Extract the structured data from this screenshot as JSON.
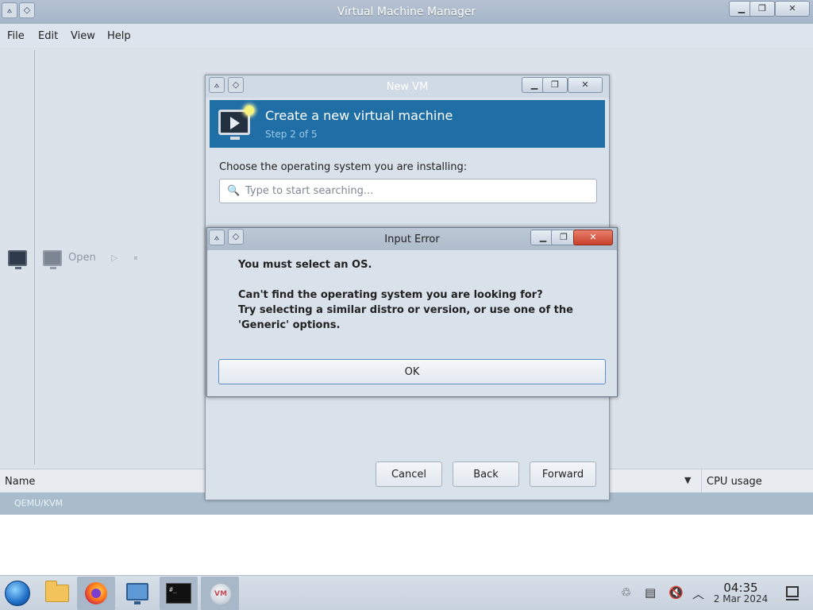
{
  "main_window": {
    "title": "Virtual Machine Manager",
    "menu": [
      "File",
      "Edit",
      "View",
      "Help"
    ],
    "toolbar": {
      "open_label": "Open"
    },
    "table_headers": {
      "name": "Name",
      "cpu": "CPU usage"
    },
    "connection_label": "QEMU/KVM"
  },
  "new_vm": {
    "title": "New VM",
    "heading": "Create a new virtual machine",
    "step": "Step 2 of 5",
    "choose_label": "Choose the operating system you are installing:",
    "search_placeholder": "Type to start searching...",
    "buttons": {
      "cancel": "Cancel",
      "back": "Back",
      "forward": "Forward"
    }
  },
  "error_dialog": {
    "title": "Input Error",
    "line1": "You must select an OS.",
    "line2": "Can't find the operating system you are looking for?",
    "line3": "Try selecting a similar distro or version, or use one of the 'Generic' options.",
    "ok_label": "OK"
  },
  "taskbar": {
    "apps": [
      "start-menu",
      "file-manager",
      "firefox",
      "network-settings",
      "terminal",
      "virt-manager"
    ],
    "time": "04:35",
    "date": "2 Mar 2024"
  },
  "colors": {
    "header_blue": "#1f6fa6",
    "step_text": "#9bc7ea",
    "ok_border": "#5b8fc7"
  }
}
